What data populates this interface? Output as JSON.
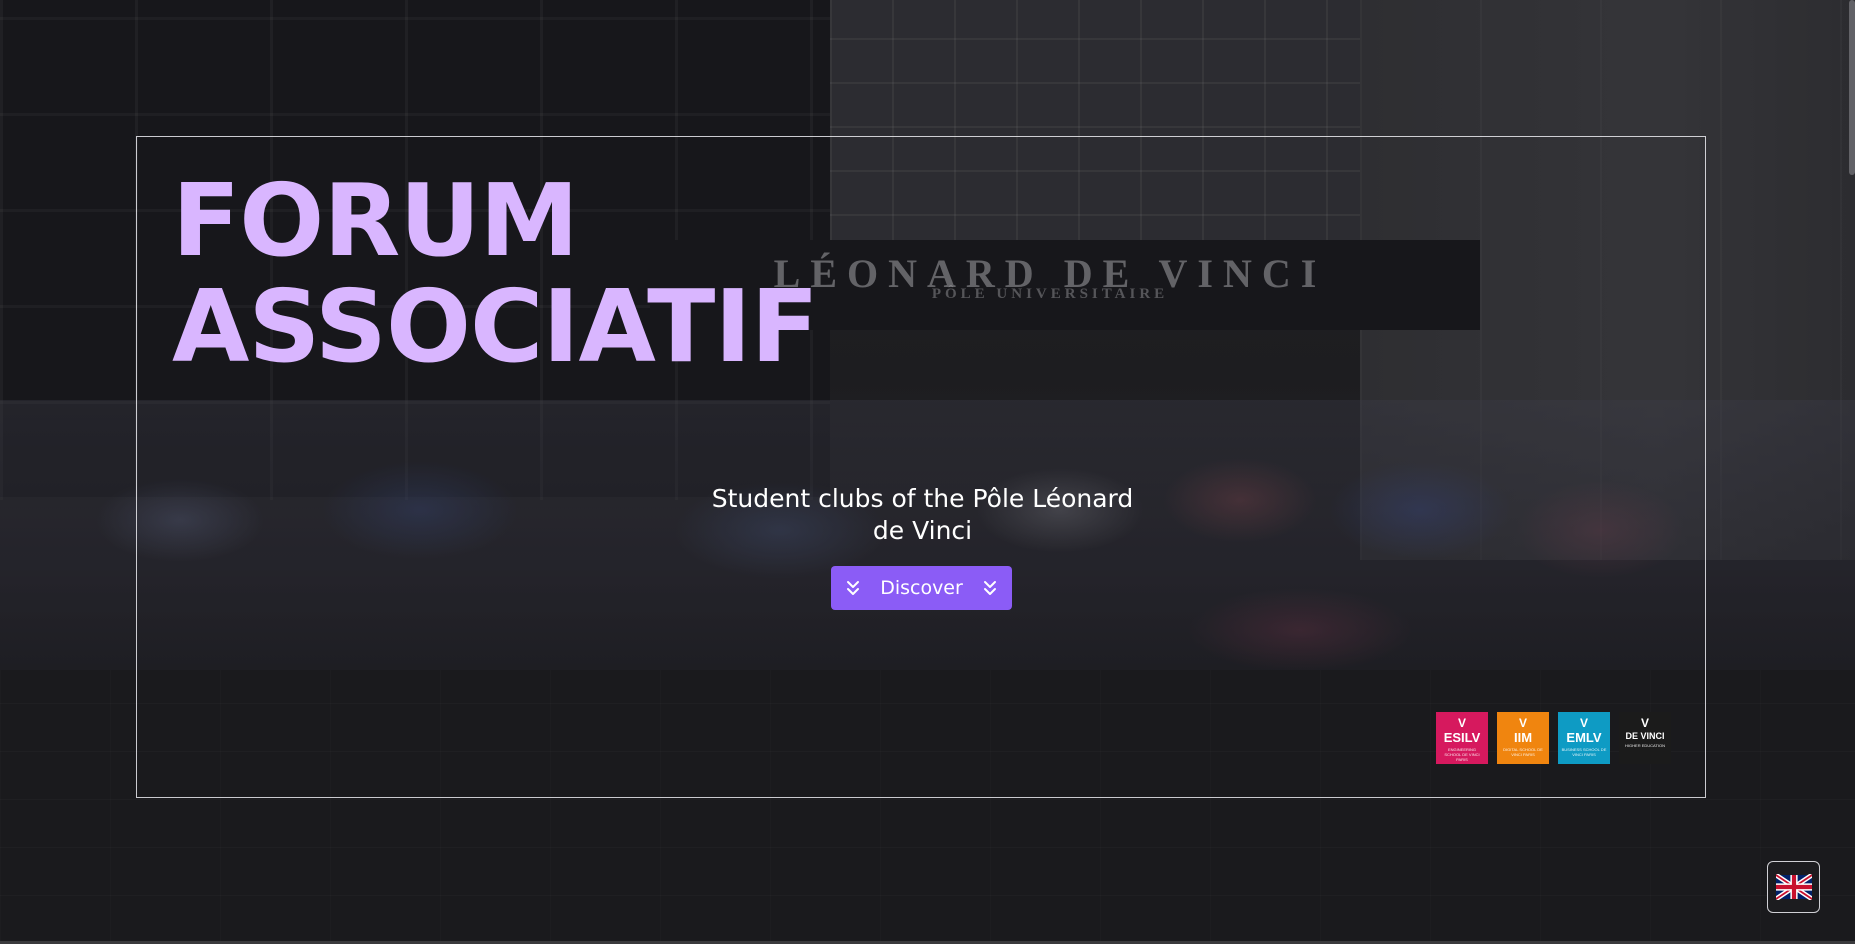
{
  "hero": {
    "title_line1": "FORUM",
    "title_line2": "ASSOCIATIF",
    "tagline": "Student clubs of the Pôle Léonard de Vinci",
    "discover_label": "Discover",
    "title_color": "#d9b6ff",
    "button_color": "#8b5cf6"
  },
  "background": {
    "sign_text": "LÉONARD DE VINCI",
    "sign_subtext": "PÔLE UNIVERSITAIRE"
  },
  "logos": [
    {
      "name": "ESILV",
      "sub": "ENGINEERING SCHOOL DE VINCI PARIS",
      "color": "#d6195e"
    },
    {
      "name": "IIM",
      "sub": "DIGITAL SCHOOL DE VINCI PARIS",
      "color": "#f0850f"
    },
    {
      "name": "EMLV",
      "sub": "BUSINESS SCHOOL DE VINCI PARIS",
      "color": "#0e9bc4"
    },
    {
      "name": "DE VINCI",
      "sub": "HIGHER EDUCATION",
      "color": "#1b1b1b"
    }
  ],
  "language": {
    "icon": "uk-flag-icon"
  }
}
